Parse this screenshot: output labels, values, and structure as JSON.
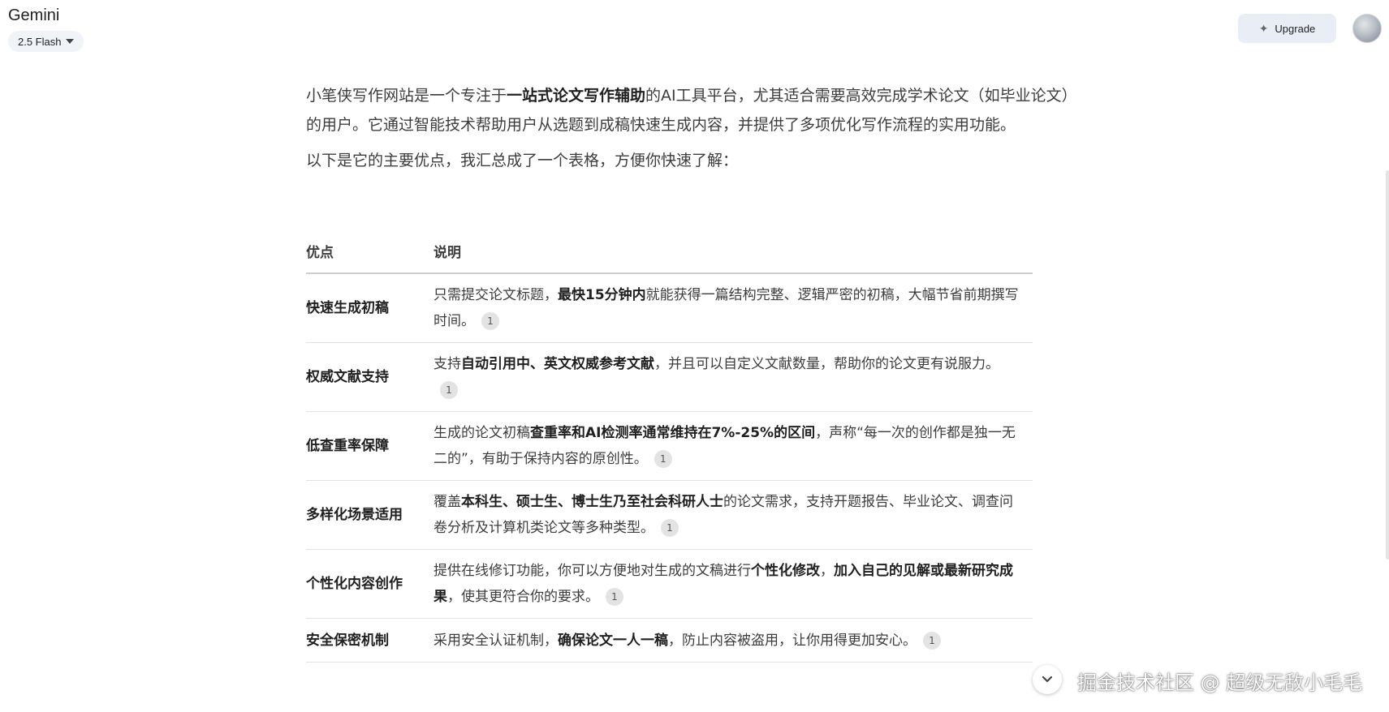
{
  "header": {
    "app_title": "Gemini",
    "model": "2.5 Flash",
    "upgrade_label": "Upgrade"
  },
  "content": {
    "intro": {
      "p1": "小笔侠写作网站是一个专注于",
      "b1": "一站式论文写作辅助",
      "p2": "的AI工具平台，尤其适合需要高效完成学术论文（如毕业论文）的用户。它通过智能技术帮助用户从选题到成稿快速生成内容，并提供了多项优化写作流程的实用功能。"
    },
    "lead": "以下是它的主要优点，我汇总成了一个表格，方便你快速了解：",
    "table": {
      "headers": [
        "优点",
        "说明"
      ],
      "rows": [
        {
          "name": "快速生成初稿",
          "a": "只需提交论文标题，",
          "b": "最快15分钟内",
          "c": "就能获得一篇结构完整、逻辑严密的初稿，大幅节省前期撰写时间。",
          "d": "",
          "e": "",
          "cite": "1"
        },
        {
          "name": "权威文献支持",
          "a": "支持",
          "b": "自动引用中、英文权威参考文献",
          "c": "，并且可以自定义文献数量，帮助你的论文更有说服力。",
          "d": "",
          "e": "",
          "cite": "1"
        },
        {
          "name": "低查重率保障",
          "a": "生成的论文初稿",
          "b": "查重率和AI检测率通常维持在7%-25%的区间",
          "c": "，声称“每一次的创作都是独一无二的”，有助于保持内容的原创性。",
          "d": "",
          "e": "",
          "cite": "1"
        },
        {
          "name": "多样化场景适用",
          "a": "覆盖",
          "b": "本科生、硕士生、博士生乃至社会科研人士",
          "c": "的论文需求，支持开题报告、毕业论文、调查问卷分析及计算机类论文等多种类型。",
          "d": "",
          "e": "",
          "cite": "1"
        },
        {
          "name": "个性化内容创作",
          "a": "提供在线修订功能，你可以方便地对生成的文稿进行",
          "b": "个性化修改",
          "c": "，",
          "d": "加入自己的见解或最新研究成果",
          "e": "，使其更符合你的要求。",
          "cite": "1"
        },
        {
          "name": "安全保密机制",
          "a": "采用安全认证机制，",
          "b": "确保论文一人一稿",
          "c": "，防止内容被盗用，让你用得更加安心。",
          "d": "",
          "e": "",
          "cite": "1"
        }
      ]
    }
  },
  "watermark": "掘金技术社区 @ 超级无敌小毛毛",
  "icons": {
    "model_dropdown": "chevron-down-icon",
    "upgrade": "sparkle-icon",
    "scroll_down": "chevron-down-icon"
  }
}
